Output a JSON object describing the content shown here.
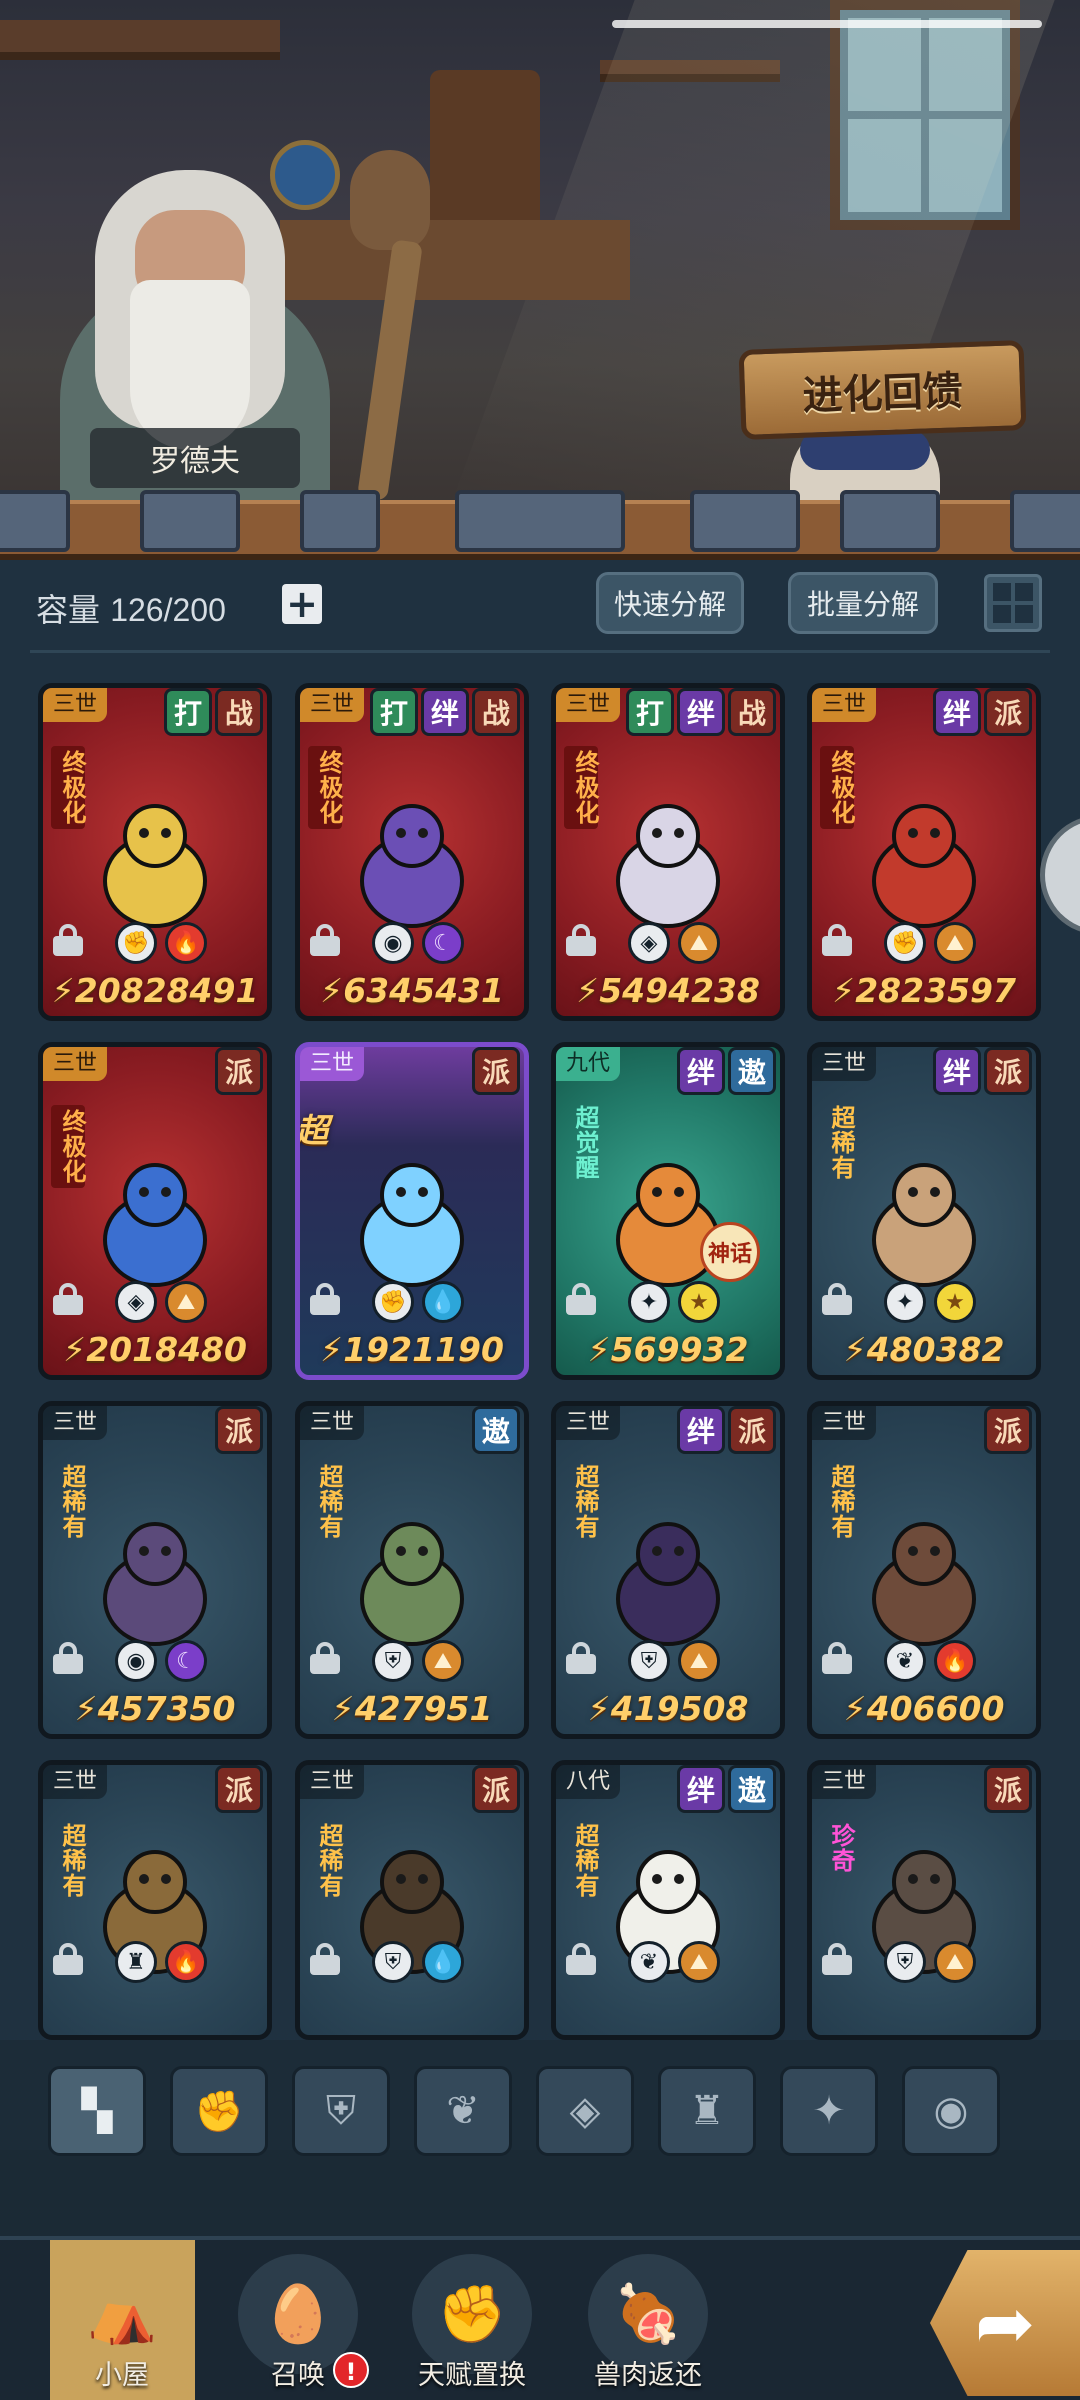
{
  "scene": {
    "npc_name": "罗德夫",
    "evolution_button": "进化回馈"
  },
  "toolbar": {
    "capacity_label": "容量",
    "capacity_value": "126/200",
    "add_label": "+",
    "quick_decompose": "快速分解",
    "batch_decompose": "批量分解"
  },
  "cards": [
    {
      "gen": "三世",
      "tags": [
        "打",
        "战"
      ],
      "rarity": "终极化",
      "elements": [
        "fist",
        "fire"
      ],
      "power": "20828491",
      "theme": "red"
    },
    {
      "gen": "三世",
      "tags": [
        "打",
        "绊",
        "战"
      ],
      "rarity": "终极化",
      "elements": [
        "eye",
        "moon"
      ],
      "power": "6345431",
      "theme": "red"
    },
    {
      "gen": "三世",
      "tags": [
        "打",
        "绊",
        "战"
      ],
      "rarity": "终极化",
      "elements": [
        "alien",
        "earth"
      ],
      "power": "5494238",
      "theme": "red"
    },
    {
      "gen": "三世",
      "tags": [
        "绊",
        "派"
      ],
      "rarity": "终极化",
      "elements": [
        "fist",
        "earth"
      ],
      "power": "2823597",
      "theme": "red"
    },
    {
      "gen": "三世",
      "tags": [
        "派"
      ],
      "rarity": "终极化",
      "elements": [
        "alien",
        "earth"
      ],
      "power": "2018480",
      "theme": "red"
    },
    {
      "gen": "三世",
      "tags": [
        "派"
      ],
      "rarity": "超巨力",
      "elements": [
        "fist",
        "water"
      ],
      "power": "1921190",
      "theme": "purple"
    },
    {
      "gen": "九代",
      "tags": [
        "绊",
        "遨"
      ],
      "rarity": "超觉醒",
      "elements": [
        "cross",
        "star"
      ],
      "power": "569932",
      "theme": "green",
      "badge": "神话"
    },
    {
      "gen": "三世",
      "tags": [
        "绊",
        "派"
      ],
      "rarity": "超稀有",
      "elements": [
        "cross",
        "star"
      ],
      "power": "480382",
      "theme": "blue"
    },
    {
      "gen": "三世",
      "tags": [
        "派"
      ],
      "rarity": "超稀有",
      "elements": [
        "eye",
        "moon"
      ],
      "power": "457350",
      "theme": "blue"
    },
    {
      "gen": "三世",
      "tags": [
        "遨"
      ],
      "rarity": "超稀有",
      "elements": [
        "shield",
        "earth"
      ],
      "power": "427951",
      "theme": "blue"
    },
    {
      "gen": "三世",
      "tags": [
        "绊",
        "派"
      ],
      "rarity": "超稀有",
      "elements": [
        "shield",
        "earth"
      ],
      "power": "419508",
      "theme": "blue"
    },
    {
      "gen": "三世",
      "tags": [
        "派"
      ],
      "rarity": "超稀有",
      "elements": [
        "leaf",
        "fire"
      ],
      "power": "406600",
      "theme": "blue"
    },
    {
      "gen": "三世",
      "tags": [
        "派"
      ],
      "rarity": "超稀有",
      "elements": [
        "tower",
        "fire"
      ],
      "power": "",
      "theme": "blue"
    },
    {
      "gen": "三世",
      "tags": [
        "派"
      ],
      "rarity": "超稀有",
      "elements": [
        "shield",
        "water"
      ],
      "power": "",
      "theme": "blue"
    },
    {
      "gen": "八代",
      "tags": [
        "绊",
        "遨"
      ],
      "rarity": "超稀有",
      "elements": [
        "leaf",
        "earth"
      ],
      "power": "",
      "theme": "blue"
    },
    {
      "gen": "三世",
      "tags": [
        "派"
      ],
      "rarity": "珍奇",
      "elements": [
        "shield",
        "earth"
      ],
      "power": "",
      "theme": "blue"
    }
  ],
  "filters": [
    "all-icon",
    "fist-icon",
    "shield-icon",
    "leaf-icon",
    "alien-icon",
    "tower-icon",
    "cross-icon",
    "eye-icon"
  ],
  "bottom_nav": {
    "home": "小屋",
    "summon": "召唤",
    "talent": "天赋置换",
    "meat": "兽肉返还",
    "summon_badge": "!"
  },
  "colors": {
    "panel_bg": "#1f3140",
    "power_text": "#ffcf6a",
    "tag_pai": "#7b2a22",
    "tag_ban": "#6a3aa6",
    "tag_da": "#2f8b5a",
    "tag_ao": "#2f6b9c"
  }
}
